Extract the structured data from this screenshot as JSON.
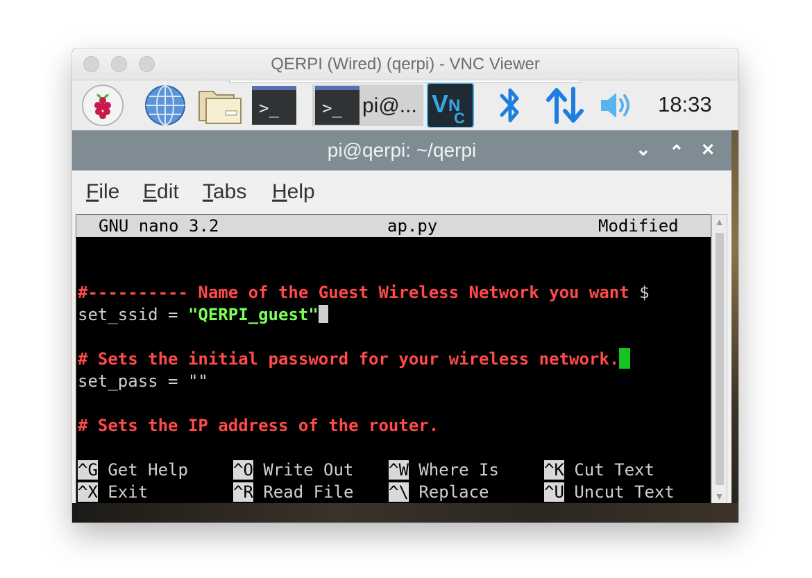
{
  "window": {
    "title": "QERPI (Wired) (qerpi) - VNC Viewer"
  },
  "taskbar": {
    "items": [
      {
        "name": "raspberry-menu",
        "icon": "raspberry-icon"
      },
      {
        "name": "web-browser",
        "icon": "globe-icon"
      },
      {
        "name": "file-manager",
        "icon": "folder-icon"
      },
      {
        "name": "terminal",
        "icon": "terminal-icon"
      },
      {
        "name": "open-terminal",
        "icon": "terminal-icon",
        "label": "pi@..."
      }
    ],
    "tray": [
      "vnc-icon",
      "bluetooth-icon",
      "network-icon",
      "volume-icon"
    ],
    "clock": "18:33",
    "terminal_prompt_glyph": ">_"
  },
  "terminal_window": {
    "title": "pi@qerpi: ~/qerpi",
    "controls": {
      "minimize": "⌄",
      "maximize": "⌃",
      "close": "✕"
    },
    "menu": [
      {
        "first": "F",
        "rest": "ile"
      },
      {
        "first": "E",
        "rest": "dit"
      },
      {
        "first": "T",
        "rest": "abs"
      },
      {
        "first": "H",
        "rest": "elp"
      }
    ]
  },
  "nano": {
    "version": "GNU nano 3.2",
    "filename": "ap.py",
    "status": "Modified",
    "lines": {
      "comment1": "#---------- Name of the Guest Wireless Network you want ",
      "comment1_overflow": "$",
      "ssid_prefix": "set_ssid = ",
      "ssid_value": "\"QERPI_guest\"",
      "comment2": "# Sets the initial password for your wireless network.",
      "pass_line": "set_pass = \"\"",
      "comment3": "# Sets the IP address of the router."
    },
    "shortcuts": [
      {
        "key": "^G",
        "label": "Get Help"
      },
      {
        "key": "^O",
        "label": "Write Out"
      },
      {
        "key": "^W",
        "label": "Where Is"
      },
      {
        "key": "^K",
        "label": "Cut Text"
      },
      {
        "key": "^X",
        "label": "Exit"
      },
      {
        "key": "^R",
        "label": "Read File"
      },
      {
        "key": "^\\",
        "label": "Replace"
      },
      {
        "key": "^U",
        "label": "Uncut Text"
      }
    ]
  },
  "colors": {
    "comment": "#ff4a4a",
    "string": "#7dff5a",
    "cursor": "#15c41f",
    "titlebar": "#7f8c93"
  }
}
